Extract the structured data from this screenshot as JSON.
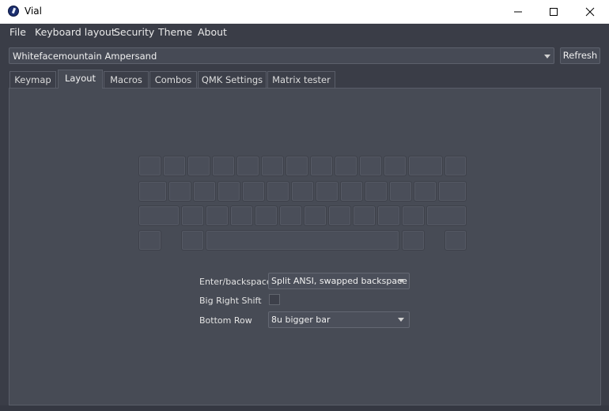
{
  "window": {
    "title": "Vial"
  },
  "menu": [
    "File",
    "Keyboard layout",
    "Security",
    "Theme",
    "About"
  ],
  "device_selector": {
    "value": "Whitefacemountain Ampersand"
  },
  "refresh_label": "Refresh",
  "tabs": [
    {
      "label": "Keymap",
      "active": false
    },
    {
      "label": "Layout",
      "active": true
    },
    {
      "label": "Macros",
      "active": false
    },
    {
      "label": "Combos",
      "active": false
    },
    {
      "label": "QMK Settings",
      "active": false
    },
    {
      "label": "Matrix tester",
      "active": false
    }
  ],
  "layout_options": {
    "enter_backspace": {
      "label": "Enter/backspace",
      "value": "Split ANSI, swapped backspace"
    },
    "big_right_shift": {
      "label": "Big Right Shift",
      "checked": false
    },
    "bottom_row": {
      "label": "Bottom Row",
      "value": "8u bigger bar"
    }
  },
  "colors": {
    "background": "#3a3d47",
    "panel": "#474b55",
    "key": "#4a4e59"
  }
}
